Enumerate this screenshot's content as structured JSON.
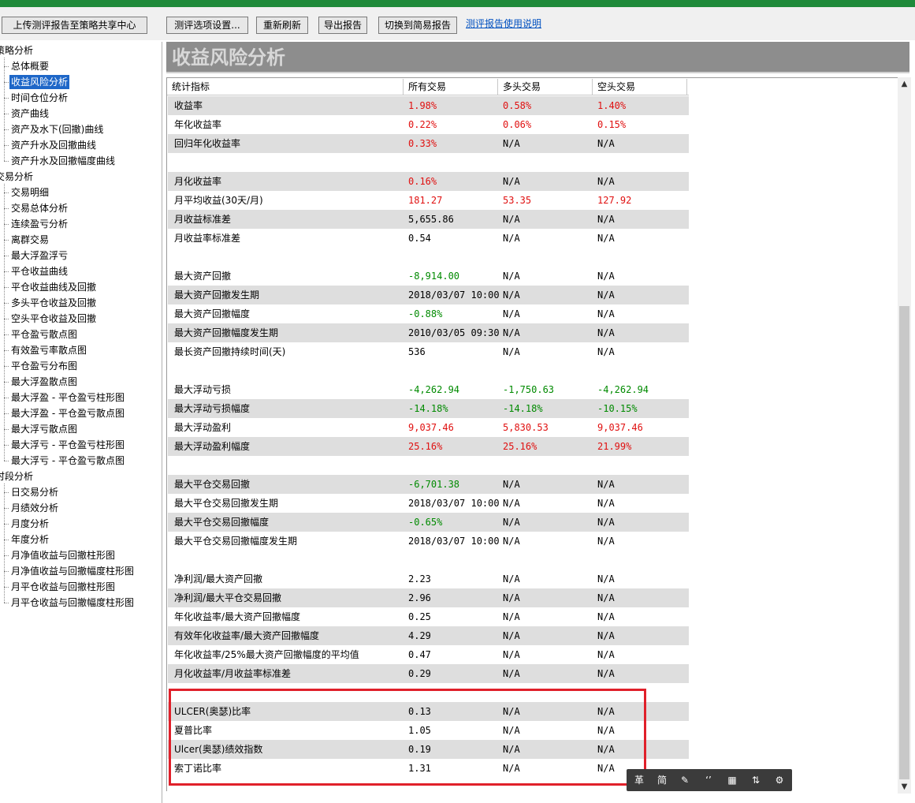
{
  "toolbar": {
    "upload_label": "上传测评报告至策略共享中心",
    "options_label": "测评选项设置...",
    "refresh_label": "重新刷新",
    "export_label": "导出报告",
    "simple_label": "切换到简易报告",
    "help_link": "测评报告使用说明"
  },
  "sidebar": {
    "groups": [
      {
        "label": "策略分析",
        "items": [
          "总体概要",
          "收益风险分析",
          "时间仓位分析",
          "资产曲线",
          "资产及水下(回撤)曲线",
          "资产升水及回撤曲线",
          "资产升水及回撤幅度曲线"
        ]
      },
      {
        "label": "交易分析",
        "items": [
          "交易明细",
          "交易总体分析",
          "连续盈亏分析",
          "离群交易",
          "最大浮盈浮亏",
          "平仓收益曲线",
          "平仓收益曲线及回撤",
          "多头平仓收益及回撤",
          "空头平仓收益及回撤",
          "平仓盈亏散点图",
          "有效盈亏率散点图",
          "平仓盈亏分布图",
          "最大浮盈散点图",
          "最大浮盈 - 平仓盈亏柱形图",
          "最大浮盈 - 平仓盈亏散点图",
          "最大浮亏散点图",
          "最大浮亏 - 平仓盈亏柱形图",
          "最大浮亏 - 平仓盈亏散点图"
        ]
      },
      {
        "label": "时段分析",
        "items": [
          "日交易分析",
          "月绩效分析",
          "月度分析",
          "年度分析",
          "月净值收益与回撤柱形图",
          "月净值收益与回撤幅度柱形图",
          "月平仓收益与回撤柱形图",
          "月平仓收益与回撤幅度柱形图"
        ]
      }
    ],
    "selected": "收益风险分析"
  },
  "main": {
    "section_title": "收益风险分析",
    "columns": [
      "统计指标",
      "所有交易",
      "多头交易",
      "空头交易"
    ],
    "rows": [
      {
        "label": "收益率",
        "all": "1.98%",
        "long": "0.58%",
        "short": "1.40%",
        "color": [
          "red",
          "red",
          "red"
        ]
      },
      {
        "label": "年化收益率",
        "all": "0.22%",
        "long": "0.06%",
        "short": "0.15%",
        "color": [
          "red",
          "red",
          "red"
        ]
      },
      {
        "label": "回归年化收益率",
        "all": "0.33%",
        "long": "N/A",
        "short": "N/A",
        "color": [
          "red",
          "",
          ""
        ]
      },
      {
        "blank": true
      },
      {
        "label": "月化收益率",
        "all": "0.16%",
        "long": "N/A",
        "short": "N/A",
        "color": [
          "red",
          "",
          ""
        ]
      },
      {
        "label": "月平均收益(30天/月)",
        "all": "181.27",
        "long": "53.35",
        "short": "127.92",
        "color": [
          "red",
          "red",
          "red"
        ]
      },
      {
        "label": "月收益标准差",
        "all": "5,655.86",
        "long": "N/A",
        "short": "N/A",
        "color": [
          "",
          "",
          ""
        ]
      },
      {
        "label": "月收益率标准差",
        "all": "0.54",
        "long": "N/A",
        "short": "N/A",
        "color": [
          "",
          "",
          ""
        ]
      },
      {
        "blank": true
      },
      {
        "label": "最大资产回撤",
        "all": "-8,914.00",
        "long": "N/A",
        "short": "N/A",
        "color": [
          "green",
          "",
          ""
        ]
      },
      {
        "label": "最大资产回撤发生期",
        "all": "2018/03/07 10:00",
        "long": "N/A",
        "short": "N/A",
        "color": [
          "",
          "",
          ""
        ]
      },
      {
        "label": "最大资产回撤幅度",
        "all": "-0.88%",
        "long": "N/A",
        "short": "N/A",
        "color": [
          "green",
          "",
          ""
        ]
      },
      {
        "label": "最大资产回撤幅度发生期",
        "all": "2010/03/05 09:30",
        "long": "N/A",
        "short": "N/A",
        "color": [
          "",
          "",
          ""
        ]
      },
      {
        "label": "最长资产回撤持续时间(天)",
        "all": "536",
        "long": "N/A",
        "short": "N/A",
        "color": [
          "",
          "",
          ""
        ]
      },
      {
        "blank": true
      },
      {
        "label": "最大浮动亏损",
        "all": "-4,262.94",
        "long": "-1,750.63",
        "short": "-4,262.94",
        "color": [
          "green",
          "green",
          "green"
        ]
      },
      {
        "label": "最大浮动亏损幅度",
        "all": "-14.18%",
        "long": "-14.18%",
        "short": "-10.15%",
        "color": [
          "green",
          "green",
          "green"
        ]
      },
      {
        "label": "最大浮动盈利",
        "all": "9,037.46",
        "long": "5,830.53",
        "short": "9,037.46",
        "color": [
          "red",
          "red",
          "red"
        ]
      },
      {
        "label": "最大浮动盈利幅度",
        "all": "25.16%",
        "long": "25.16%",
        "short": "21.99%",
        "color": [
          "red",
          "red",
          "red"
        ]
      },
      {
        "blank": true
      },
      {
        "label": "最大平仓交易回撤",
        "all": "-6,701.38",
        "long": "N/A",
        "short": "N/A",
        "color": [
          "green",
          "",
          ""
        ]
      },
      {
        "label": "最大平仓交易回撤发生期",
        "all": "2018/03/07 10:00",
        "long": "N/A",
        "short": "N/A",
        "color": [
          "",
          "",
          ""
        ]
      },
      {
        "label": "最大平仓交易回撤幅度",
        "all": "-0.65%",
        "long": "N/A",
        "short": "N/A",
        "color": [
          "green",
          "",
          ""
        ]
      },
      {
        "label": "最大平仓交易回撤幅度发生期",
        "all": "2018/03/07 10:00",
        "long": "N/A",
        "short": "N/A",
        "color": [
          "",
          "",
          ""
        ]
      },
      {
        "blank": true
      },
      {
        "label": "净利润/最大资产回撤",
        "all": "2.23",
        "long": "N/A",
        "short": "N/A",
        "color": [
          "",
          "",
          ""
        ]
      },
      {
        "label": "净利润/最大平仓交易回撤",
        "all": "2.96",
        "long": "N/A",
        "short": "N/A",
        "color": [
          "",
          "",
          ""
        ]
      },
      {
        "label": "年化收益率/最大资产回撤幅度",
        "all": "0.25",
        "long": "N/A",
        "short": "N/A",
        "color": [
          "",
          "",
          ""
        ]
      },
      {
        "label": "有效年化收益率/最大资产回撤幅度",
        "all": "4.29",
        "long": "N/A",
        "short": "N/A",
        "color": [
          "",
          "",
          ""
        ]
      },
      {
        "label": "年化收益率/25%最大资产回撤幅度的平均值",
        "all": "0.47",
        "long": "N/A",
        "short": "N/A",
        "color": [
          "",
          "",
          ""
        ]
      },
      {
        "label": "月化收益率/月收益率标准差",
        "all": "0.29",
        "long": "N/A",
        "short": "N/A",
        "color": [
          "",
          "",
          ""
        ]
      },
      {
        "blank": true
      },
      {
        "label": "ULCER(奥瑟)比率",
        "all": "0.13",
        "long": "N/A",
        "short": "N/A",
        "color": [
          "",
          "",
          ""
        ]
      },
      {
        "label": "夏普比率",
        "all": "1.05",
        "long": "N/A",
        "short": "N/A",
        "color": [
          "",
          "",
          ""
        ]
      },
      {
        "label": "Ulcer(奥瑟)绩效指数",
        "all": "0.19",
        "long": "N/A",
        "short": "N/A",
        "color": [
          "",
          "",
          ""
        ]
      },
      {
        "label": "索丁诺比率",
        "all": "1.31",
        "long": "N/A",
        "short": "N/A",
        "color": [
          "",
          "",
          ""
        ]
      }
    ]
  },
  "ime": {
    "mode": "革",
    "script": "简",
    "icons": [
      "brush-icon",
      "quote-icon",
      "keyboard-icon",
      "toggle-icon",
      "settings-icon"
    ]
  },
  "colors": {
    "positive": "#e01010",
    "negative": "#008a00",
    "selected": "#1e67c8",
    "highlight": "#e0202a"
  }
}
